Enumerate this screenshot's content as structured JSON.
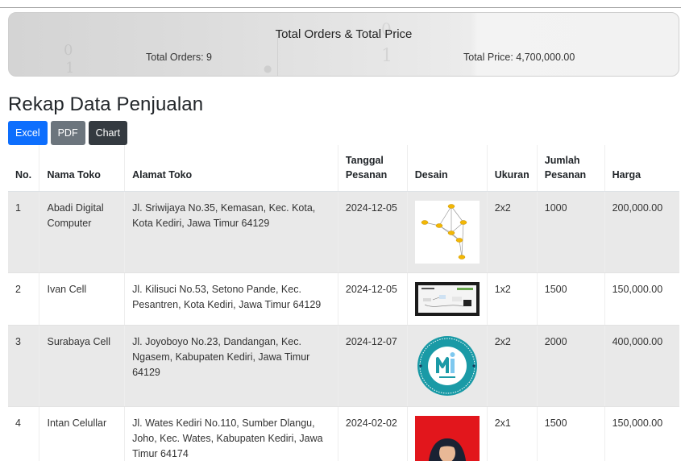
{
  "summary": {
    "title": "Total Orders & Total Price",
    "orders_text": "Total Orders: 9",
    "price_text": "Total Price: 4,700,000.00"
  },
  "page_title": "Rekap Data Penjualan",
  "buttons": {
    "excel": "Excel",
    "pdf": "PDF",
    "chart": "Chart"
  },
  "table": {
    "headers": {
      "no": "No.",
      "nama": "Nama Toko",
      "alamat": "Alamat Toko",
      "tanggal": "Tanggal Pesanan",
      "desain": "Desain",
      "ukuran": "Ukuran",
      "jumlah": "Jumlah Pesanan",
      "harga": "Harga"
    },
    "rows": [
      {
        "no": "1",
        "nama": "Abadi Digital Computer",
        "alamat": "Jl. Sriwijaya No.35, Kemasan, Kec. Kota, Kota Kediri, Jawa Timur 64129",
        "tanggal": "2024-12-05",
        "desain": "network-graph-design-thumbnail",
        "ukuran": "2x2",
        "jumlah": "1000",
        "harga": "200,000.00"
      },
      {
        "no": "2",
        "nama": "Ivan Cell",
        "alamat": "Jl. Kilisuci No.53, Setono Pande, Kec. Pesantren, Kota Kediri, Jawa Timur 64129",
        "tanggal": "2024-12-05",
        "desain": "screen-diagram-design-thumbnail",
        "ukuran": "1x2",
        "jumlah": "1500",
        "harga": "150,000.00"
      },
      {
        "no": "3",
        "nama": "Surabaya Cell",
        "alamat": "Jl. Joyoboyo No.23, Dandangan, Kec. Ngasem, Kabupaten Kediri, Jawa Timur 64129",
        "tanggal": "2024-12-07",
        "desain": "circular-logo-design-thumbnail",
        "ukuran": "2x2",
        "jumlah": "2000",
        "harga": "400,000.00"
      },
      {
        "no": "4",
        "nama": "Intan Celullar",
        "alamat": "Jl. Wates Kediri No.110, Sumber Dlangu, Joho, Kec. Wates, Kabupaten Kediri, Jawa Timur 64174",
        "tanggal": "2024-02-02",
        "desain": "portrait-photo-design-thumbnail",
        "ukuran": "2x1",
        "jumlah": "1500",
        "harga": "150,000.00"
      }
    ]
  },
  "colors": {
    "excel_button": "#0d6efd",
    "pdf_button": "#6c757d",
    "chart_button": "#343a40",
    "stripe": "#e9e9e9",
    "logo_teal": "#1a9aa6",
    "photo_red": "#e2161c"
  }
}
